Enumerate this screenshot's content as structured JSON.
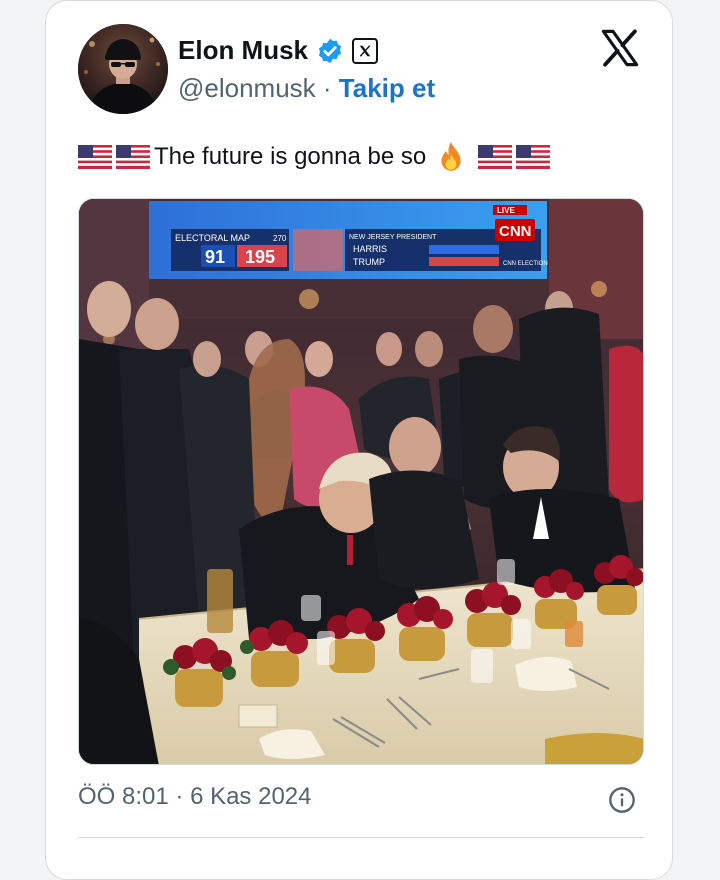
{
  "author": {
    "name": "Elon Musk",
    "handle": "@elonmusk",
    "separator": "·",
    "follow_label": "Takip et"
  },
  "tweet": {
    "text": "The future is gonna be so",
    "emoji_flags_before": 2,
    "emoji_flags_after": 2,
    "emoji_mid": "fire"
  },
  "media": {
    "broadcast": {
      "network_logo": "CNN",
      "live_label": "LIVE",
      "map_title": "ELECTORAL MAP",
      "needed_label": "270",
      "harris_votes": "91",
      "trump_votes": "195",
      "race_label": "NEW JERSEY PRESIDENT",
      "candidate_1": "HARRIS",
      "candidate_2": "TRUMP",
      "footer_label": "CNN ELECTION"
    }
  },
  "meta": {
    "time": "ÖÖ 8:01",
    "date_separator": "·",
    "date": "6 Kas 2024"
  },
  "icons": {
    "verified": "verified-badge-icon",
    "org": "x-org-badge-icon",
    "brand": "x-logo-icon",
    "info": "info-icon"
  },
  "colors": {
    "accent": "#1d72c9",
    "verified": "#1d9bf0",
    "text": "#0f1419",
    "muted": "#536471"
  }
}
